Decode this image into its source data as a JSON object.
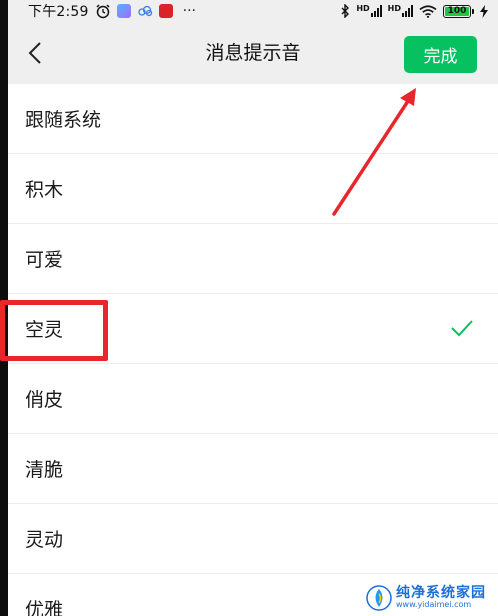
{
  "status_bar": {
    "time": "下午2:59",
    "dots": "···",
    "hd1": "HD",
    "hd2": "HD",
    "battery": "100"
  },
  "header": {
    "title": "消息提示音",
    "done_label": "完成"
  },
  "ringtones": [
    {
      "label": "跟随系统",
      "selected": false
    },
    {
      "label": "积木",
      "selected": false
    },
    {
      "label": "可爱",
      "selected": false
    },
    {
      "label": "空灵",
      "selected": true
    },
    {
      "label": "俏皮",
      "selected": false
    },
    {
      "label": "清脆",
      "selected": false
    },
    {
      "label": "灵动",
      "selected": false
    },
    {
      "label": "优雅",
      "selected": false
    }
  ],
  "watermark": {
    "name": "纯净系统家园",
    "url": "www.yidaimei.com"
  },
  "colors": {
    "accent": "#07c160",
    "annotation": "#e8262b",
    "check": "#07c160",
    "header_bg": "#efefef"
  },
  "icons": {
    "back": "chevron-left-icon",
    "check": "check-icon"
  }
}
